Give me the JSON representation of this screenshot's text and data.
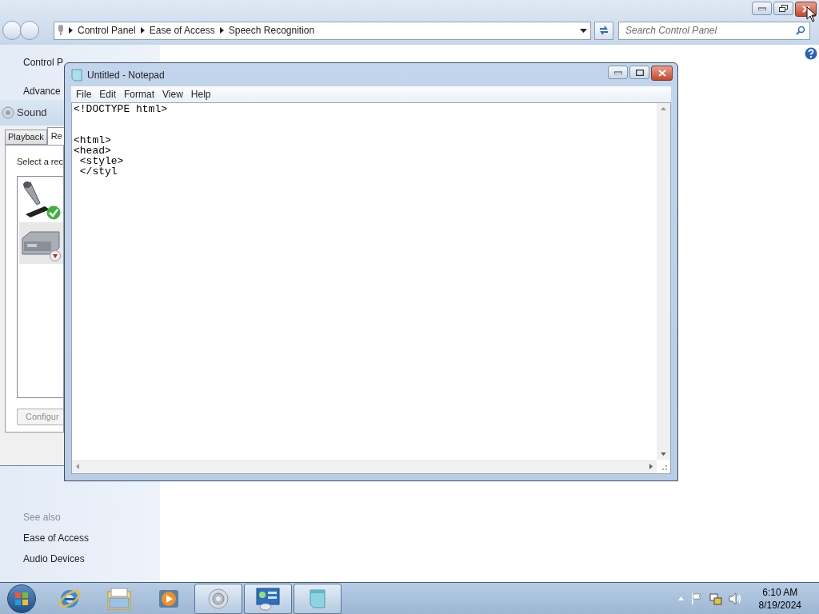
{
  "control_panel": {
    "breadcrumb": [
      "Control Panel",
      "Ease of Access",
      "Speech Recognition"
    ],
    "search": {
      "placeholder": "Search Control Panel"
    },
    "sidebar_links": [
      "Control P",
      "Advance"
    ],
    "see_also": {
      "heading": "See also",
      "links": [
        "Ease of Access",
        "Audio Devices"
      ]
    }
  },
  "sound_dialog": {
    "title": "Sound",
    "tabs": [
      {
        "label": "Playback",
        "selected": false
      },
      {
        "label": "Re",
        "selected": true
      }
    ],
    "instruction": "Select a rec",
    "devices": [
      {
        "kind": "microphone",
        "default": true,
        "plugged_in": true,
        "selected": false
      },
      {
        "kind": "line-in",
        "default": false,
        "plugged_in": false,
        "selected": true
      }
    ],
    "configure_button": {
      "label": "Configur",
      "disabled": true
    }
  },
  "notepad": {
    "title": "Untitled - Notepad",
    "menu": [
      "File",
      "Edit",
      "Format",
      "View",
      "Help"
    ],
    "text": "<!DOCTYPE html>\n\n\n<html>\n<head>\n <style>\n </styl"
  },
  "taskbar": {
    "apps": [
      {
        "kind": "browser",
        "running": false
      },
      {
        "kind": "folder",
        "running": false
      },
      {
        "kind": "media-player",
        "running": false
      },
      {
        "kind": "speaker",
        "running": true
      },
      {
        "kind": "control-panel",
        "running": true
      },
      {
        "kind": "notepad",
        "running": true
      }
    ],
    "time": "6:10 AM",
    "date": "8/19/2024"
  }
}
